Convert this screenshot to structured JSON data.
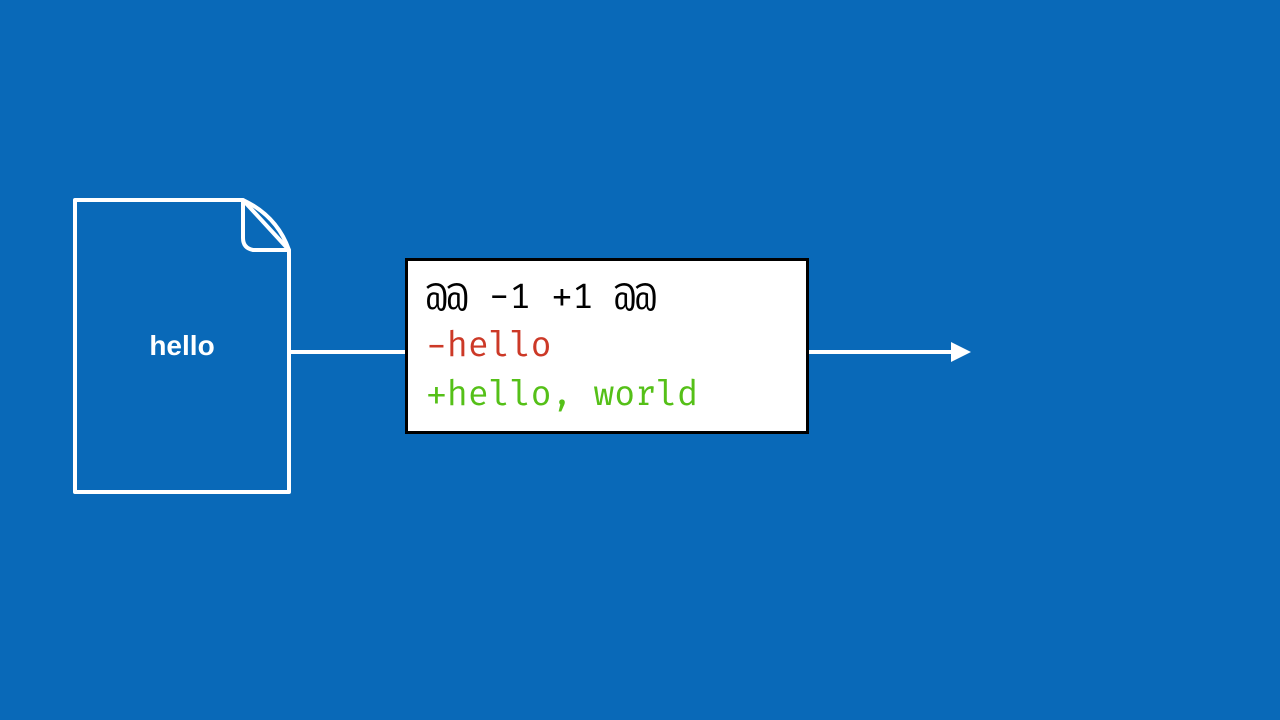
{
  "file": {
    "label": "hello"
  },
  "diff": {
    "header": "@@ -1 +1 @@",
    "removed": "-hello",
    "added": "+hello, world"
  },
  "colors": {
    "background": "#0969b8",
    "stroke": "#ffffff",
    "removed": "#cc3927",
    "added": "#55c018"
  }
}
